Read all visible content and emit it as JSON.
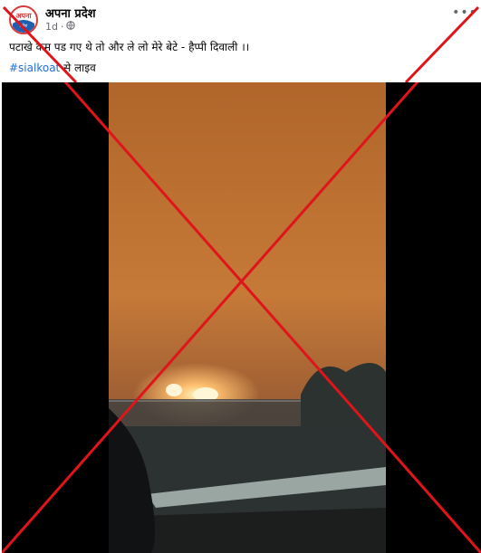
{
  "post": {
    "page_name": "अपना प्रदेश",
    "timestamp": "1d",
    "separator": "·",
    "audience_icon": "globe-icon",
    "more_icon": "more-options-icon",
    "caption": "पटाखे कम पड गए थे तो और ले लो मेरे बेटे - हैप्पी दिवाली ।।",
    "hashtag": "#sialkoat",
    "hashtag_suffix": " से लाइव"
  },
  "avatar_text": {
    "top": "अपना",
    "bottom": "प्रदेश"
  },
  "overlay": {
    "type": "red-cross-mark",
    "color": "#e0141b"
  },
  "colors": {
    "hashtag": "#216fdb",
    "secondary_text": "#65676b",
    "video_sky": "#c7752e",
    "fire": "#ffd27a"
  }
}
